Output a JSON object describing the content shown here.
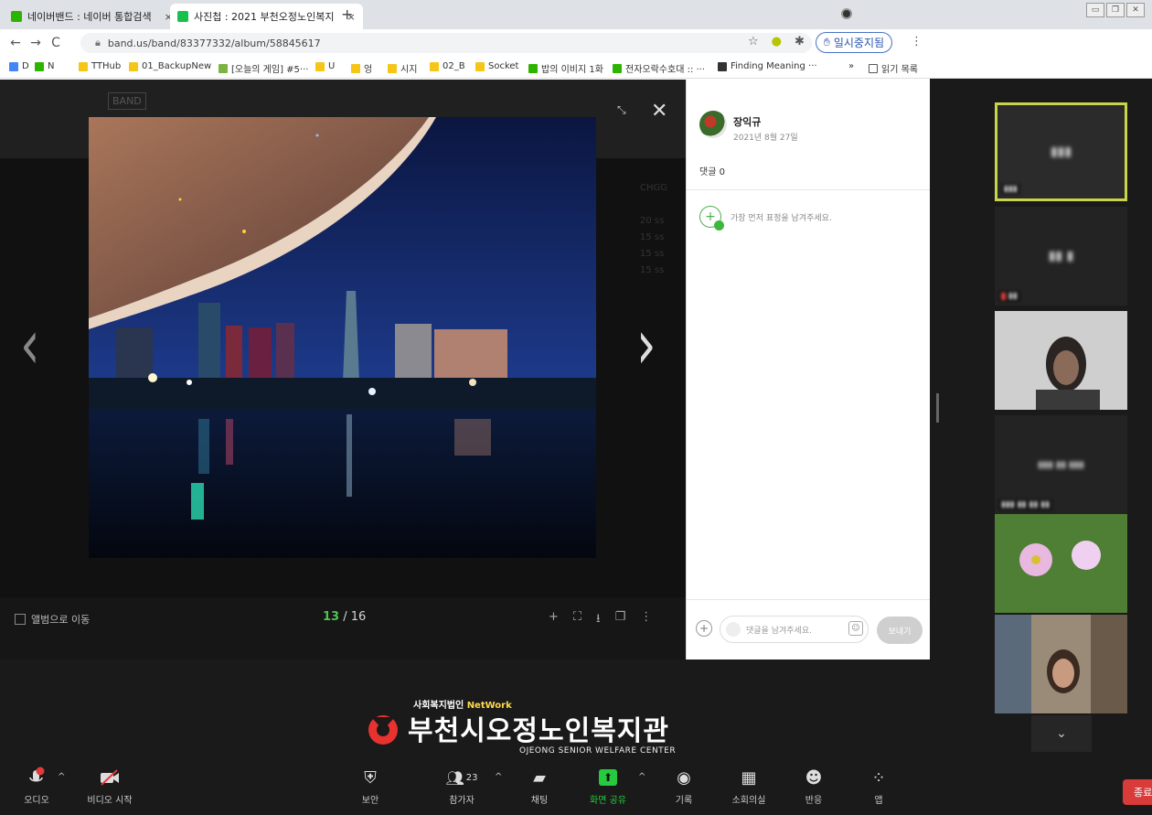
{
  "zoom": {
    "toolbar": {
      "audio": "오디오",
      "video": "비디오 시작",
      "security": "보안",
      "participants": "참가자",
      "participants_count": "23",
      "chat": "채팅",
      "share": "화면 공유",
      "record": "기록",
      "breakout": "소회의실",
      "reactions": "반응",
      "apps": "앱",
      "end": "종료"
    },
    "colors": {
      "share_green": "#27c93f",
      "end_red": "#d93a3a",
      "active_speaker": "#c9d44a"
    }
  },
  "browser": {
    "tabs": [
      {
        "label": "네이버밴드 : 네이버 통합검색",
        "close": "×"
      },
      {
        "label": "사진첩 : 2021 부천오정노인복지",
        "close": "×"
      }
    ],
    "new_tab": "+",
    "url": "band.us/band/83377332/album/58845617",
    "pause_label": "일시중지됨",
    "bookmarks": [
      {
        "label": "D"
      },
      {
        "label": "N"
      },
      {
        "label": "TTHub"
      },
      {
        "label": "01_BackupNew"
      },
      {
        "label": "[오늘의 게임] #5···"
      },
      {
        "label": "U"
      },
      {
        "label": "엉"
      },
      {
        "label": "시지"
      },
      {
        "label": "02_B"
      },
      {
        "label": "Socket"
      },
      {
        "label": "밥의 이비지 1화"
      },
      {
        "label": "전자오락수호대 :: ···"
      },
      {
        "label": "Finding Meaning ···"
      }
    ],
    "bookmarks_more": "»",
    "reading_list": "읽기 목록"
  },
  "viewer": {
    "counter_current": "13",
    "counter_sep": " / ",
    "counter_total": "16",
    "album_link": "앨범으로 이동",
    "band_logo": "BAND"
  },
  "post": {
    "author": "장익규",
    "date": "2021년 8월 27일",
    "comment_count": "댓글 0",
    "reaction_prompt": "가장 먼저 표정을 남겨주세요.",
    "comment_placeholder": "댓글을 남겨주세요.",
    "send": "보내기"
  },
  "overlay_logo": {
    "subtitle_pre": "사회복지법인 ",
    "subtitle_brand": "NetWork",
    "title": "부천시오정노인복지관",
    "english": "OJEONG SENIOR WELFARE CENTER"
  }
}
